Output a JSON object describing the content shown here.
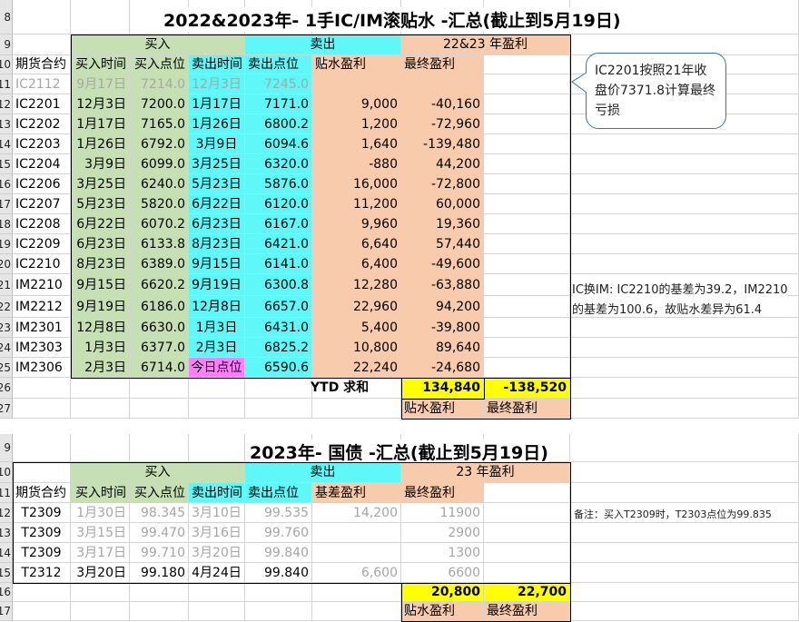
{
  "rows1": [
    "8",
    "9",
    "10",
    "11",
    "12",
    "13",
    "14",
    "15",
    "16",
    "17",
    "18",
    "19",
    "20",
    "21",
    "22",
    "23",
    "24",
    "25",
    "26",
    "27"
  ],
  "rows2": [
    "9",
    "10",
    "11",
    "12",
    "13",
    "14",
    "15",
    "16",
    "17"
  ],
  "t1": {
    "title": "2022&2023年- 1手IC/IM滚贴水 -汇总(截止到5月19日)",
    "g_buy": "买入",
    "g_sell": "卖出",
    "g_pnl": "22&23 年盈利",
    "h": [
      "期货合约",
      "买入时间",
      "买入点位",
      "卖出时间",
      "卖出点位",
      "贴水盈利",
      "最终盈利"
    ],
    "rows": [
      [
        "IC2112",
        "9月17日",
        "7214.0",
        "12月3日",
        "7245.0",
        "",
        ""
      ],
      [
        "IC2201",
        "12月3日",
        "7200.0",
        "1月17日",
        "7171.0",
        "9,000",
        "-40,160"
      ],
      [
        "IC2202",
        "1月17日",
        "7165.0",
        "1月26日",
        "6800.2",
        "1,200",
        "-72,960"
      ],
      [
        "IC2203",
        "1月26日",
        "6792.0",
        "3月9日",
        "6094.6",
        "1,640",
        "-139,480"
      ],
      [
        "IC2204",
        "3月9日",
        "6099.0",
        "3月25日",
        "6320.0",
        "-880",
        "44,200"
      ],
      [
        "IC2206",
        "3月25日",
        "6240.0",
        "5月23日",
        "5876.0",
        "16,000",
        "-72,800"
      ],
      [
        "IC2207",
        "5月23日",
        "5820.0",
        "6月22日",
        "6120.0",
        "11,200",
        "60,000"
      ],
      [
        "IC2208",
        "6月22日",
        "6070.2",
        "6月23日",
        "6167.0",
        "9,960",
        "19,360"
      ],
      [
        "IC2209",
        "6月23日",
        "6133.8",
        "8月23日",
        "6421.0",
        "6,640",
        "57,440"
      ],
      [
        "IC2210",
        "8月23日",
        "6389.0",
        "9月15日",
        "6141.0",
        "6,400",
        "-49,600"
      ],
      [
        "IM2210",
        "9月15日",
        "6620.2",
        "9月19日",
        "6300.8",
        "12,280",
        "-63,880"
      ],
      [
        "IM2212",
        "9月19日",
        "6186.0",
        "12月8日",
        "6657.0",
        "22,960",
        "94,200"
      ],
      [
        "IM2301",
        "12月8日",
        "6630.0",
        "1月3日",
        "6431.0",
        "5,400",
        "-39,800"
      ],
      [
        "IM2303",
        "1月3日",
        "6377.0",
        "2月3日",
        "6825.2",
        "10,800",
        "89,640"
      ],
      [
        "IM2306",
        "2月3日",
        "6714.0",
        "今日点位",
        "6590.6",
        "22,240",
        "-24,680"
      ]
    ],
    "ytd_label": "YTD 求和",
    "ytd_sum1": "134,840",
    "ytd_sum2": "-138,520",
    "foot1": "贴水盈利",
    "foot2": "最终盈利",
    "callout": "IC2201按照21年收盘价7371.8计算最终亏损",
    "note1": "IC换IM: IC2210的基差为39.2，IM2210",
    "note2": "的基差为100.6，故贴水差异为61.4"
  },
  "t2": {
    "title": "2023年- 国债 -汇总(截止到5月19日)",
    "g_buy": "买入",
    "g_sell": "卖出",
    "g_pnl": "23 年盈利",
    "h": [
      "期货合约",
      "买入时间",
      "买入点位",
      "卖出时间",
      "卖出点位",
      "基差盈利",
      "最终盈利"
    ],
    "rows": [
      [
        "T2309",
        "1月30日",
        "98.345",
        "3月10日",
        "99.535",
        "14,200",
        "11900"
      ],
      [
        "T2309",
        "3月15日",
        "99.470",
        "3月16日",
        "99.760",
        "",
        "2900"
      ],
      [
        "T2309",
        "3月17日",
        "99.710",
        "3月20日",
        "99.840",
        "",
        "1300"
      ],
      [
        "T2312",
        "3月20日",
        "99.180",
        "4月24日",
        "99.840",
        "6,600",
        "6600"
      ]
    ],
    "sum1": "20,800",
    "sum2": "22,700",
    "foot1": "贴水盈利",
    "foot2": "最终盈利",
    "note": "备注：买入T2309时，T2303点位为99.835"
  },
  "colors": {
    "green": "#c6e0b4",
    "cyan": "#5ff7f7",
    "peach": "#f8cbad",
    "yellow": "#ffff00",
    "pink": "#ff80ff"
  }
}
